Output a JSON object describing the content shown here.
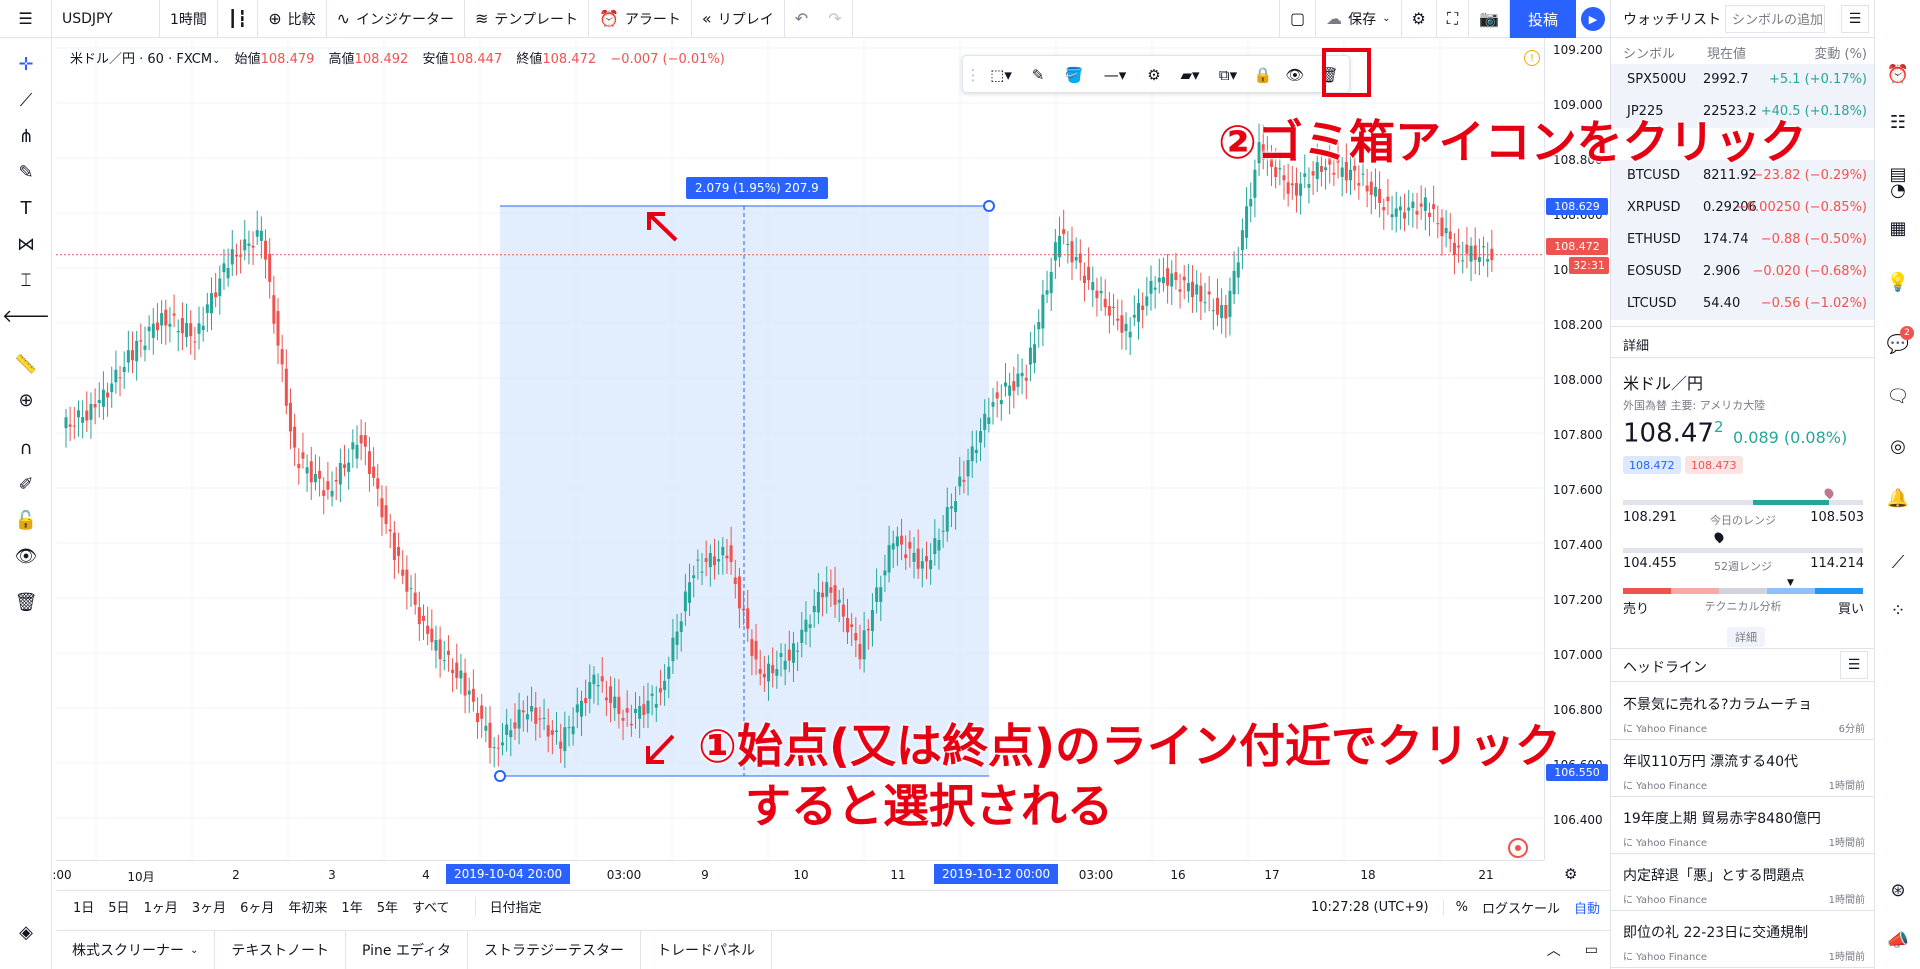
{
  "topbar": {
    "menu_icon": "hamburger-icon",
    "symbol": "USDJPY",
    "interval": "1時間",
    "compare": "比較",
    "indicators": "インジケーター",
    "templates": "テンプレート",
    "alert": "アラート",
    "replay": "リプレイ",
    "save": "保存",
    "post": "投稿"
  },
  "legend": {
    "title": "米ドル／円 · 60 · FXCM",
    "open_label": "始値",
    "open": "108.479",
    "high_label": "高値",
    "high": "108.492",
    "low_label": "安値",
    "low": "108.447",
    "close_label": "終値",
    "close": "108.472",
    "change": "−0.007 (−0.01%)"
  },
  "price_axis": {
    "labels": [
      "109.200",
      "109.000",
      "108.800",
      "108.600",
      "108.400",
      "108.200",
      "108.000",
      "107.800",
      "107.600",
      "107.400",
      "107.200",
      "107.000",
      "106.800",
      "106.600",
      "106.400"
    ],
    "tag_top": "108.629",
    "tag_current": "108.472",
    "tag_countdown": "32:31",
    "tag_bottom": "106.550"
  },
  "time_axis": {
    "labels": [
      ":00",
      "10月",
      "2",
      "3",
      "4",
      "03:00",
      "9",
      "10",
      "11",
      "03:00",
      "16",
      "17",
      "18",
      "21"
    ],
    "tag_start": "2019-10-04  20:00",
    "tag_end": "2019-10-12  00:00"
  },
  "range_tool": {
    "label": "2.079 (1.95%) 207.9"
  },
  "range_bar": {
    "items": [
      "1日",
      "5日",
      "1ヶ月",
      "3ヶ月",
      "6ヶ月",
      "年初来",
      "1年",
      "5年",
      "すべて"
    ],
    "date_range": "日付指定",
    "clock": "10:27:28 (UTC+9)",
    "percent": "%",
    "log": "ログスケール",
    "auto": "自動"
  },
  "bottom_tabs": [
    "株式スクリーナー",
    "テキストノート",
    "Pine エディタ",
    "ストラテジーテスター",
    "トレードパネル"
  ],
  "watchlist": {
    "title": "ウォッチリスト",
    "add_placeholder": "シンボルの追加",
    "col_symbol": "シンボル",
    "col_price": "現在値",
    "col_change": "変動 (%)",
    "rows": [
      {
        "symbol": "SPX500U",
        "price": "2992.7",
        "change": "+5.1 (+0.17%)",
        "dir": "pos"
      },
      {
        "symbol": "JP225",
        "price": "22523.2",
        "change": "+40.5 (+0.18%)",
        "dir": "pos"
      },
      {
        "symbol": "",
        "price": "",
        "change": "",
        "dir": "neg"
      },
      {
        "symbol": "BTCUSD",
        "price": "8211.92",
        "change": "−23.82 (−0.29%)",
        "dir": "neg"
      },
      {
        "symbol": "XRPUSD",
        "price": "0.29206",
        "change": "−0.00250 (−0.85%)",
        "dir": "neg"
      },
      {
        "symbol": "ETHUSD",
        "price": "174.74",
        "change": "−0.88 (−0.50%)",
        "dir": "neg"
      },
      {
        "symbol": "EOSUSD",
        "price": "2.906",
        "change": "−0.020 (−0.68%)",
        "dir": "neg"
      },
      {
        "symbol": "LTCUSD",
        "price": "54.40",
        "change": "−0.56 (−1.02%)",
        "dir": "neg"
      }
    ]
  },
  "details": {
    "header": "詳細",
    "name": "米ドル／円",
    "sub": "外国為替 主要: アメリカ大陸",
    "price": "108.47",
    "price_sup": "2",
    "change": "0.089 (0.08%)",
    "bid": "108.472",
    "ask": "108.473",
    "day_low": "108.291",
    "day_high": "108.503",
    "day_label": "今日のレンジ",
    "wk_low": "104.455",
    "wk_high": "114.214",
    "wk_label": "52週レンジ",
    "sell": "売り",
    "tech_label": "テクニカル分析",
    "buy": "買い",
    "more": "詳細"
  },
  "headlines": {
    "header": "ヘッドライン",
    "items": [
      {
        "title": "不景気に売れる?カラムーチョ",
        "src": "に Yahoo Finance",
        "time": "6分前"
      },
      {
        "title": "年収110万円 漂流する40代",
        "src": "に Yahoo Finance",
        "time": "1時間前"
      },
      {
        "title": "19年度上期 貿易赤字8480億円",
        "src": "に Yahoo Finance",
        "time": "1時間前"
      },
      {
        "title": "内定辞退「悪」とする問題点",
        "src": "に Yahoo Finance",
        "time": "1時間前"
      },
      {
        "title": "即位の礼 22-23日に交通規制",
        "src": "に Yahoo Finance",
        "time": "1時間前"
      }
    ]
  },
  "annotations": {
    "step2": "②ゴミ箱アイコンをクリック",
    "step1_line1": "①始点(又は終点)のライン付近でクリック",
    "step1_line2": "すると選択される"
  },
  "colors": {
    "accent": "#2962ff",
    "up": "#26a69a",
    "down": "#ef5350",
    "annotation": "#e60012",
    "range_fill": "#cfe3fb"
  },
  "chart_data": {
    "type": "candlestick",
    "symbol": "USDJPY",
    "interval": "60",
    "ylim": [
      106.3,
      109.25
    ],
    "series": [
      {
        "t": 0,
        "o": 107.85,
        "c": 107.92
      },
      {
        "t": 1,
        "o": 107.92,
        "c": 108.1
      },
      {
        "t": 2,
        "o": 108.1,
        "c": 108.25
      },
      {
        "t": 3,
        "o": 108.25,
        "c": 108.18
      },
      {
        "t": 4,
        "o": 108.18,
        "c": 108.45
      },
      {
        "t": 5,
        "o": 108.45,
        "c": 108.55
      },
      {
        "t": 6,
        "o": 108.55,
        "c": 107.75
      },
      {
        "t": 7,
        "o": 107.75,
        "c": 107.62
      },
      {
        "t": 8,
        "o": 107.62,
        "c": 107.82
      },
      {
        "t": 9,
        "o": 107.82,
        "c": 107.4
      },
      {
        "t": 10,
        "o": 107.4,
        "c": 107.1
      },
      {
        "t": 11,
        "o": 107.1,
        "c": 106.95
      },
      {
        "t": 12,
        "o": 106.95,
        "c": 106.7
      },
      {
        "t": 13,
        "o": 106.7,
        "c": 106.85
      },
      {
        "t": 14,
        "o": 106.85,
        "c": 106.72
      },
      {
        "t": 15,
        "o": 106.72,
        "c": 106.95
      },
      {
        "t": 16,
        "o": 106.95,
        "c": 106.8
      },
      {
        "t": 17,
        "o": 106.8,
        "c": 106.9
      },
      {
        "t": 18,
        "o": 106.9,
        "c": 107.35
      },
      {
        "t": 19,
        "o": 107.35,
        "c": 107.4
      },
      {
        "t": 20,
        "o": 107.4,
        "c": 106.95
      },
      {
        "t": 21,
        "o": 106.95,
        "c": 107.05
      },
      {
        "t": 22,
        "o": 107.05,
        "c": 107.3
      },
      {
        "t": 23,
        "o": 107.3,
        "c": 107.05
      },
      {
        "t": 24,
        "o": 107.05,
        "c": 107.45
      },
      {
        "t": 25,
        "o": 107.45,
        "c": 107.35
      },
      {
        "t": 26,
        "o": 107.35,
        "c": 107.65
      },
      {
        "t": 27,
        "o": 107.65,
        "c": 107.95
      },
      {
        "t": 28,
        "o": 107.95,
        "c": 108.05
      },
      {
        "t": 29,
        "o": 108.05,
        "c": 108.55
      },
      {
        "t": 30,
        "o": 108.55,
        "c": 108.35
      },
      {
        "t": 31,
        "o": 108.35,
        "c": 108.2
      },
      {
        "t": 32,
        "o": 108.2,
        "c": 108.4
      },
      {
        "t": 33,
        "o": 108.4,
        "c": 108.35
      },
      {
        "t": 34,
        "o": 108.35,
        "c": 108.25
      },
      {
        "t": 35,
        "o": 108.25,
        "c": 108.85
      },
      {
        "t": 36,
        "o": 108.85,
        "c": 108.7
      },
      {
        "t": 37,
        "o": 108.7,
        "c": 108.8
      },
      {
        "t": 38,
        "o": 108.8,
        "c": 108.75
      },
      {
        "t": 39,
        "o": 108.75,
        "c": 108.62
      },
      {
        "t": 40,
        "o": 108.62,
        "c": 108.65
      },
      {
        "t": 41,
        "o": 108.65,
        "c": 108.48
      },
      {
        "t": 42,
        "o": 108.48,
        "c": 108.47
      }
    ]
  }
}
